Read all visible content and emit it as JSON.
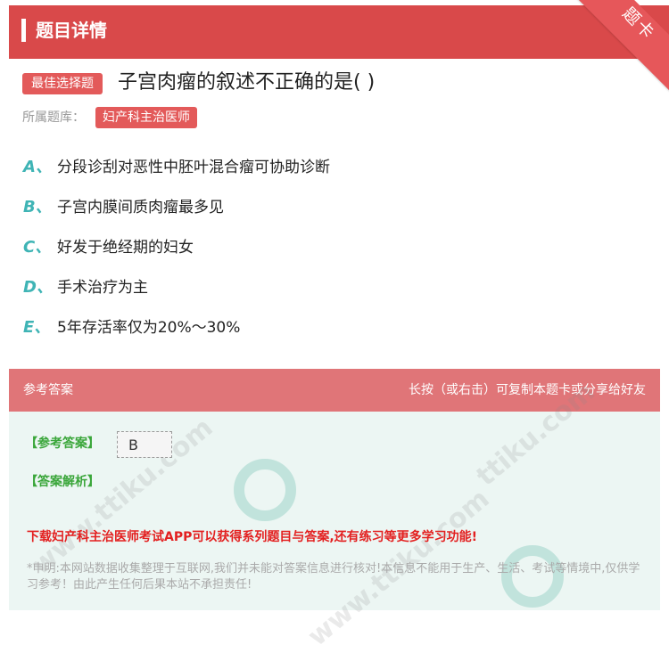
{
  "header": {
    "title": "题目详情",
    "corner_label": "题卡"
  },
  "question": {
    "type_badge": "最佳选择题",
    "text": "子宫肉瘤的叙述不正确的是( )",
    "library_label": "所属题库：",
    "library_name": "妇产科主治医师"
  },
  "options": [
    {
      "letter": "A",
      "sep": "、",
      "text": "分段诊刮对恶性中胚叶混合瘤可协助诊断"
    },
    {
      "letter": "B",
      "sep": "、",
      "text": "子宫内膜间质肉瘤最多见"
    },
    {
      "letter": "C",
      "sep": "、",
      "text": "好发于绝经期的妇女"
    },
    {
      "letter": "D",
      "sep": "、",
      "text": "手术治疗为主"
    },
    {
      "letter": "E",
      "sep": "、",
      "text": "5年存活率仅为20%～30%"
    }
  ],
  "answer": {
    "section_title": "参考答案",
    "copy_hint": "长按（或右击）可复制本题卡或分享给好友",
    "key_label": "【参考答案】",
    "key_value": "B",
    "analysis_label": "【答案解析】"
  },
  "promo": "下载妇产科主治医师考试APP可以获得系列题目与答案,还有练习等更多学习功能!",
  "disclaimer": "*申明:本网站数据收集整理于互联网,我们并未能对答案信息进行核对!本信息不能用于生产、生活、考试等情境中,仅供学习参考！由此产生任何后果本站不承担责任!",
  "colors": {
    "header": "#d9494a",
    "badge": "#e35a5a",
    "option_letter": "#3fb4b5",
    "answer_head": "#e07578",
    "answer_bg": "#ecf6f3",
    "promo": "#e32020"
  }
}
